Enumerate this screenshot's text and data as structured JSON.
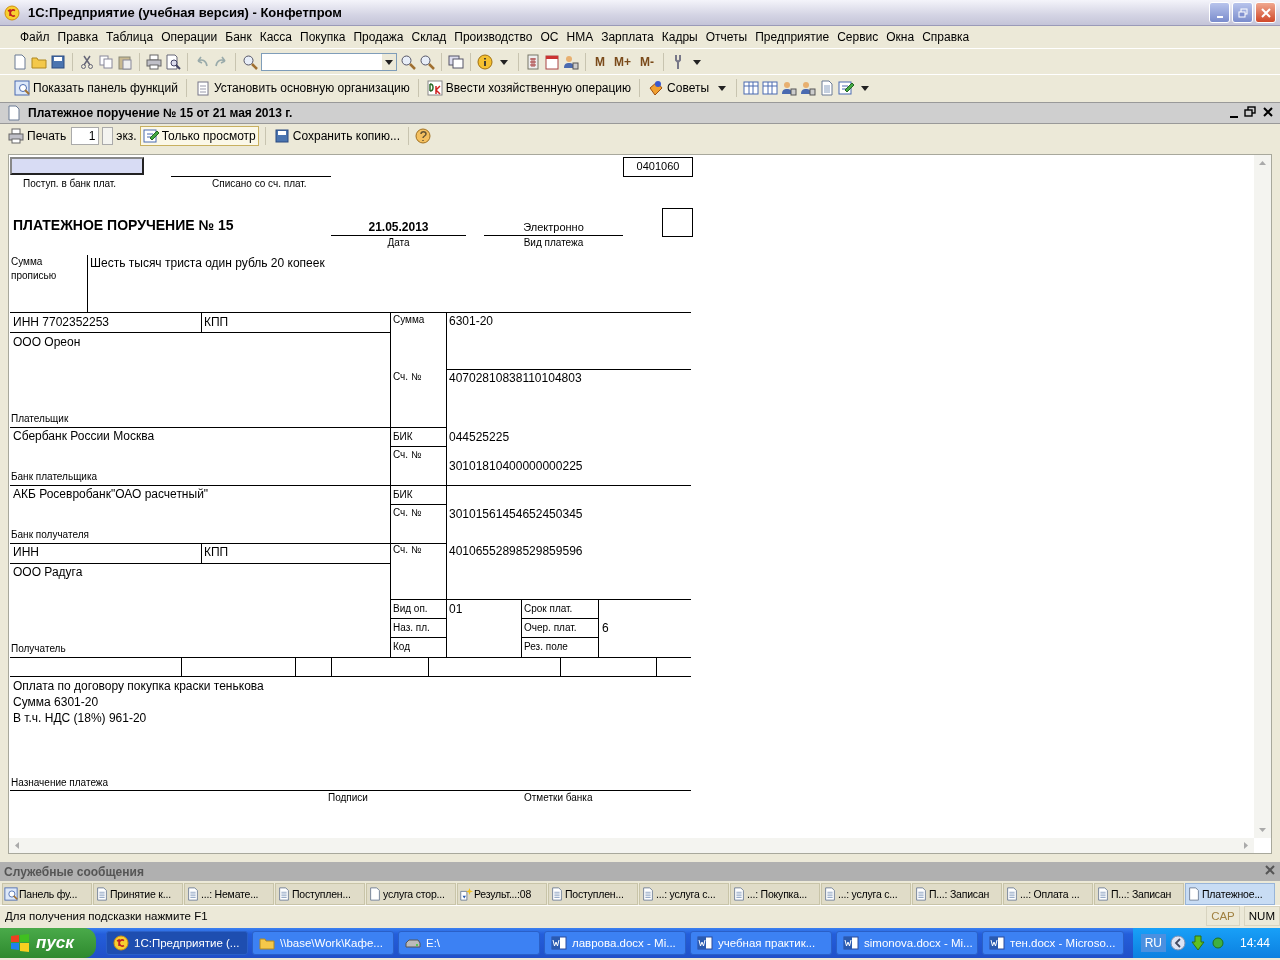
{
  "window": {
    "title": "1С:Предприятие (учебная версия) - Конфетпром"
  },
  "menu": [
    "Файл",
    "Правка",
    "Таблица",
    "Операции",
    "Банк",
    "Касса",
    "Покупка",
    "Продажа",
    "Склад",
    "Производство",
    "ОС",
    "НМА",
    "Зарплата",
    "Кадры",
    "Отчеты",
    "Предприятие",
    "Сервис",
    "Окна",
    "Справка"
  ],
  "toolbar": {
    "memory_buttons": [
      "M",
      "M+",
      "M-"
    ]
  },
  "function_toolbar": [
    "Показать панель функций",
    "Установить основную организацию",
    "Ввести хозяйственную операцию",
    "Советы"
  ],
  "document": {
    "title": "Платежное поручение № 15 от 21 мая 2013 г.",
    "toolbar": {
      "print": "Печать",
      "copies": "1",
      "copies_unit": "экз.",
      "view_only": {
        "label": "Только просмотр",
        "selected": true
      },
      "save_copy": "Сохранить копию..."
    },
    "form": {
      "form_code": "0401060",
      "received_label": "Поступ. в банк плат.",
      "debited_label": "Списано со сч. плат.",
      "title": "ПЛАТЕЖНОЕ ПОРУЧЕНИЕ № 15",
      "date": "21.05.2013",
      "date_label": "Дата",
      "payment_type": "Электронно",
      "payment_type_label": "Вид платежа",
      "amount_words_label": "Сумма прописью",
      "amount_words": "Шесть тысяч триста один рубль 20 копеек",
      "payer_inn": "ИНН 7702352253",
      "payer_kpp": "КПП",
      "amount_label": "Сумма",
      "amount": "6301-20",
      "payer_name": "ООО Ореон",
      "payer_account_label": "Сч. №",
      "payer_account": "40702810838110104803",
      "payer_label": "Плательщик",
      "payer_bank": "Сбербанк России Москва",
      "payer_bank_bik_label": "БИК",
      "payer_bank_bik": "044525225",
      "payer_bank_account_label": "Сч. №",
      "payer_bank_account": "30101810400000000225",
      "payer_bank_label": "Банк плательщика",
      "payee_bank": "АКБ Росевробанк\"ОАО расчетный\"",
      "payee_bank_bik_label": "БИК",
      "payee_bank_account_label": "Сч. №",
      "payee_bank_account": "30101561454652450345",
      "payee_bank_label": "Банк получателя",
      "payee_inn": "ИНН",
      "payee_kpp": "КПП",
      "payee_account_label": "Сч. №",
      "payee_account": "40106552898529859596",
      "payee_name": "ООО Радуга",
      "payee_label": "Получатель",
      "op_type_label": "Вид оп.",
      "op_type": "01",
      "due_label": "Срок плат.",
      "purpose_code_label": "Наз. пл.",
      "priority_label": "Очер. плат.",
      "priority": "6",
      "code_label": "Код",
      "reserve_label": "Рез. поле",
      "purpose_label": "Назначение платежа",
      "signatures_label": "Подписи",
      "bank_marks_label": "Отметки банка"
    },
    "purpose": [
      "Оплата по договору покупка краски тенькова",
      "Сумма 6301-20",
      "В т.ч. НДС  (18%) 961-20"
    ]
  },
  "messages_panel": {
    "title": "Служебные сообщения"
  },
  "window_tabs": [
    {
      "label": "Панель фу...",
      "selected": false
    },
    {
      "label": "Принятие к...",
      "selected": false
    },
    {
      "label": "...: Немате...",
      "selected": false
    },
    {
      "label": "Поступлен...",
      "selected": false
    },
    {
      "label": "услуга стор...",
      "selected": false
    },
    {
      "label": "Результ...:08",
      "selected": false
    },
    {
      "label": "Поступлен...",
      "selected": false
    },
    {
      "label": "...: услуга с...",
      "selected": false
    },
    {
      "label": "...: Покупка...",
      "selected": false
    },
    {
      "label": "...: услуга с...",
      "selected": false
    },
    {
      "label": "П...: Записан",
      "selected": false
    },
    {
      "label": "...: Оплата ...",
      "selected": false
    },
    {
      "label": "П...: Записан",
      "selected": false
    },
    {
      "label": "Платежное...",
      "selected": true
    }
  ],
  "status_bar": {
    "hint": "Для получения подсказки нажмите F1",
    "indicators": [
      {
        "label": "CAP",
        "on": false
      },
      {
        "label": "NUM",
        "on": true
      }
    ]
  },
  "taskbar": {
    "start": "пуск",
    "items": [
      {
        "label": "1С:Предприятие (...",
        "selected": true
      },
      {
        "label": "\\\\base\\Work\\Кафе...",
        "selected": false
      },
      {
        "label": "E:\\",
        "selected": false
      },
      {
        "label": "лаврова.docx - Mi...",
        "selected": false
      },
      {
        "label": "учебная практик...",
        "selected": false
      },
      {
        "label": "simonova.docx - Mi...",
        "selected": false
      },
      {
        "label": "тен.docx - Microso...",
        "selected": false
      }
    ],
    "language": "RU",
    "clock": "14:44"
  }
}
